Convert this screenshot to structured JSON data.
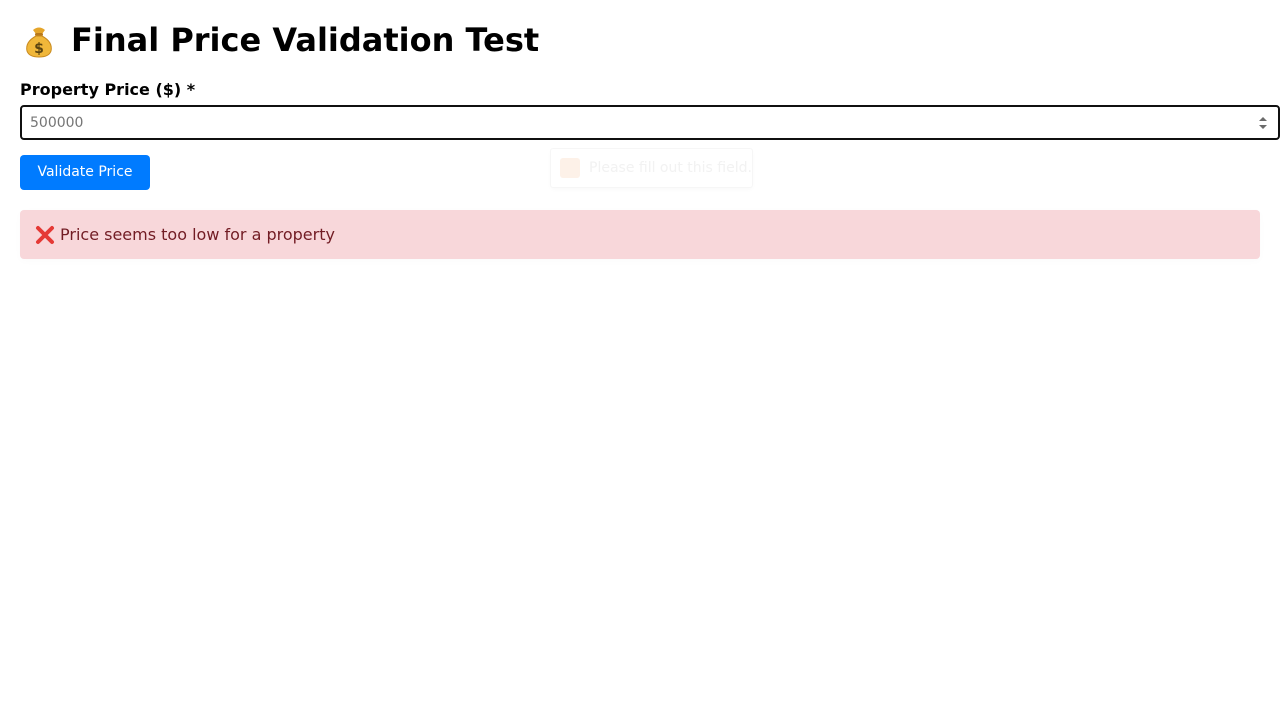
{
  "page": {
    "title": "Final Price Validation Test",
    "title_icon": "money-bag-icon"
  },
  "form": {
    "price_label": "Property Price ($) *",
    "price_input": {
      "value": "",
      "placeholder": "500000"
    },
    "validate_button_label": "Validate Price"
  },
  "tooltip": {
    "text": "Please fill out this field.",
    "icon": "warning-icon"
  },
  "alert": {
    "icon": "cross-mark-icon",
    "message": "Price seems too low for a property"
  },
  "colors": {
    "accent": "#007bff",
    "error_background": "#f8d7da",
    "error_text": "#721c24",
    "error_icon": "#e53935"
  }
}
